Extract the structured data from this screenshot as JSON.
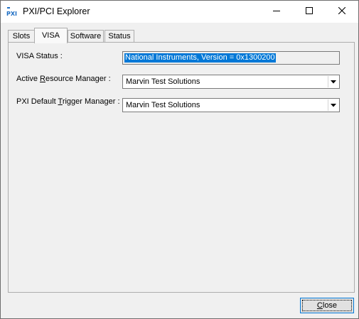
{
  "window": {
    "title": "PXI/PCI Explorer",
    "icon_name": "pxi-app-icon",
    "icon_text": "PXI",
    "controls": {
      "minimize_icon": "minimize-icon",
      "maximize_icon": "maximize-icon",
      "close_icon": "close-icon"
    }
  },
  "tabs": [
    {
      "label": "Slots",
      "active": false
    },
    {
      "label": "VISA",
      "active": true
    },
    {
      "label": "Software",
      "active": false
    },
    {
      "label": "Status",
      "active": false
    }
  ],
  "visa": {
    "status_label": "VISA Status :",
    "status_value": "National Instruments, Version = 0x1300200",
    "resource_manager_label_pre": "Active ",
    "resource_manager_label_hotkey": "R",
    "resource_manager_label_post": "esource Manager :",
    "resource_manager_value": "Marvin Test Solutions",
    "trigger_manager_label_pre": "PXI Default ",
    "trigger_manager_label_hotkey": "T",
    "trigger_manager_label_post": "rigger Manager :",
    "trigger_manager_value": "Marvin Test Solutions"
  },
  "footer": {
    "close_hotkey": "C",
    "close_rest": "lose"
  },
  "colors": {
    "accent": "#0078d7",
    "selection_bg": "#0078d7",
    "window_bg": "#f0f0f0"
  }
}
